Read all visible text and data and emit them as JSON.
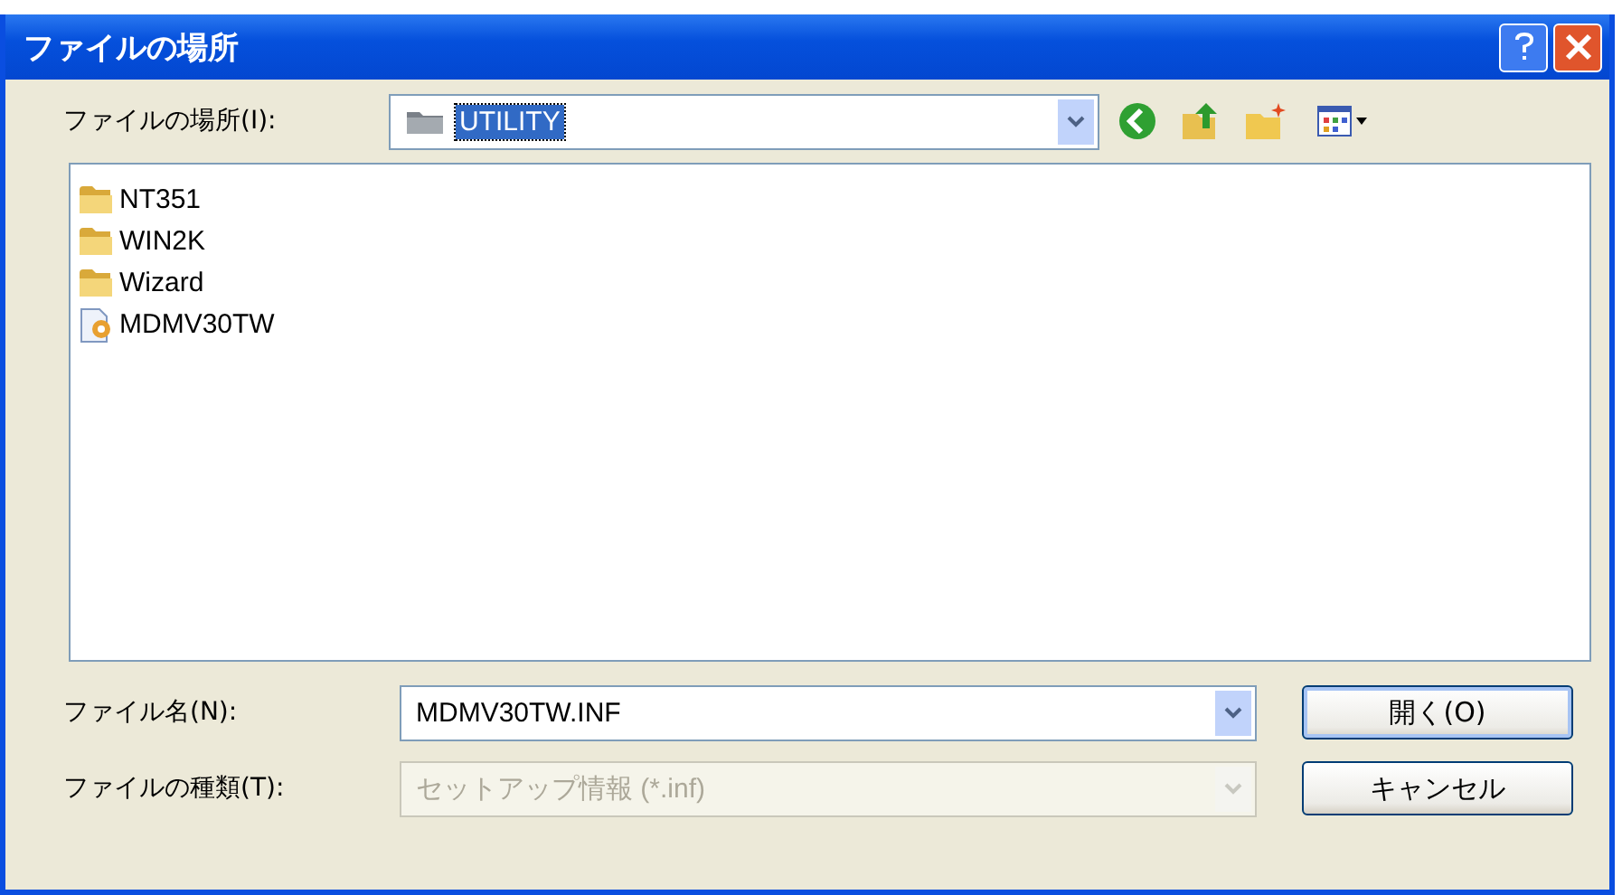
{
  "window": {
    "title": "ファイルの場所"
  },
  "location": {
    "label": "ファイルの場所(I):",
    "value": "UTILITY"
  },
  "files": [
    {
      "name": "NT351",
      "kind": "folder"
    },
    {
      "name": "WIN2K",
      "kind": "folder"
    },
    {
      "name": "Wizard",
      "kind": "folder"
    },
    {
      "name": "MDMV30TW",
      "kind": "setup"
    }
  ],
  "file_name": {
    "label": "ファイル名(N):",
    "value": "MDMV30TW.INF"
  },
  "file_type": {
    "label": "ファイルの種類(T):",
    "value": "セットアップ情報 (*.inf)",
    "disabled": true
  },
  "buttons": [
    {
      "label": "開く(O)",
      "default": true
    },
    {
      "label": "キャンセル",
      "default": false
    }
  ]
}
